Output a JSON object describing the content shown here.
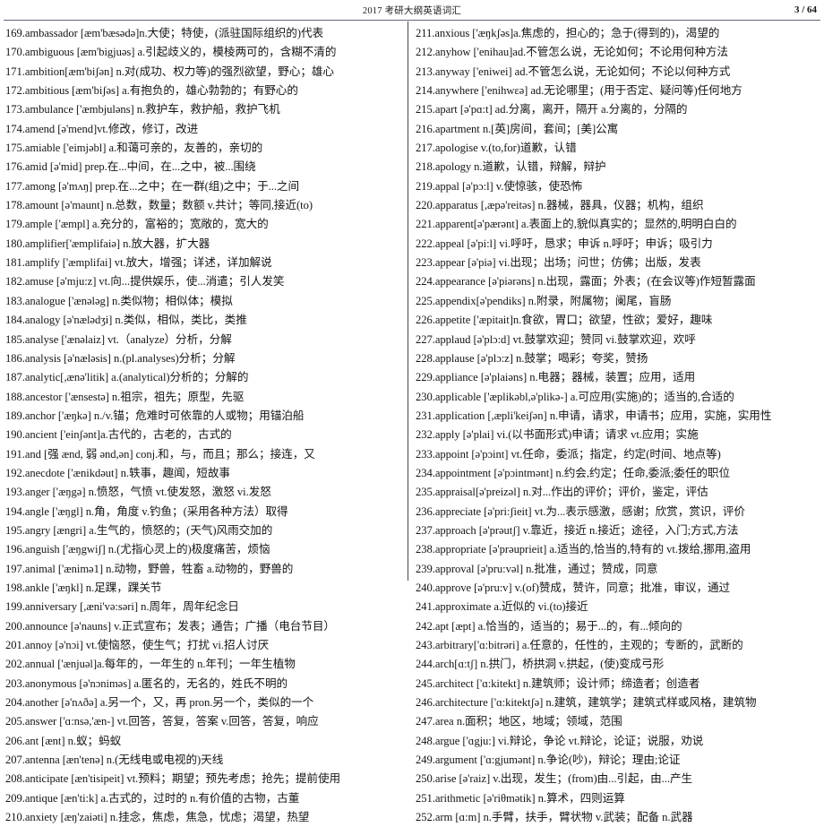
{
  "header": {
    "title": "2017 考研大纲英语词汇",
    "page_number": "3 / 64"
  },
  "columns": {
    "left": [
      "169.ambassador    [æm'bæsədə]n.大使；特使，(派驻国际组织的)代表",
      "170.ambiguous     [æm'bigjuəs] a.引起歧义的，模棱两可的，含糊不清的",
      "171.ambition[æm'biʃən]    n.对(成功、权力等)的强烈欲望，野心；雄心",
      "172.ambitious     [æm'biʃəs]    a.有抱负的，雄心勃勃的；有野心的",
      "173.ambulance     ['æmbjuləns] n.救护车，救护船，救护飞机",
      "174.amend   [ə'mend]vt.修改，修订，改进",
      "175.amiable  ['eimjəbl]      a.和蔼可亲的，友善的，亲切的",
      "176.amid     [ə'mid]  prep.在...中间，在...之中，被...围绕",
      "177.among    [ə'mʌŋ]  prep.在...之中；在一群(组)之中；于...之间",
      "178.amount  [ə'maunt]        n.总数，数量；数额 v.共计；等同,接近(to)",
      "179.ample    ['æmpl]  a.充分的，富裕的；宽敞的，宽大的",
      "180.amplifier['æmplifaiə]  n.放大器，扩大器",
      "181.amplify  ['æmplifai]    vt.放大，增强；详述，详加解说",
      "182.amuse    [ə'mju:z] vt.向...提供娱乐，使...消遣；引人发笑",
      "183.analogue  ['ænələg]      n.类似物；相似体；模拟",
      "184.analogy  [ə'nælədʒi]    n.类似，相似，类比，类推",
      "185.analyse  ['ænəlaiz]    vt.（analyze）分析，分解",
      "186.analysis  [ə'næləsis]    n.(pl.analyses)分析；分解",
      "187.analytic[,ænə'litik]      a.(analytical)分析的；分解的",
      "188.ancestor ['ænsestə]     n.祖宗，祖先；原型，先驱",
      "189.anchor   ['æŋkə]  n./v.锚；危难时可依靠的人或物；用锚泊船",
      "190.ancient  ['einʃənt]a.古代的，古老的，古式的",
      "191.and   [强 ænd, 弱 ənd,ən]      conj.和，与，而且；那么；接连，又",
      "192.anecdote ['ænikdəut]   n.轶事，趣闻，短故事",
      "193.anger     ['æŋgə]  n.愤怒，气愤 vt.使发怒，激怒 vi.发怒",
      "194.angle     ['æŋgl]   n.角，角度 v.钓鱼；(采用各种方法）取得",
      "195.angry     [ængri] a.生气的，愤怒的；(天气)风雨交加的",
      "196.anguish  ['æŋgwiʃ]      n.(尤指心灵上的)极度痛苦，烦恼",
      "197.animal   ['ænimə1]      n.动物，野兽，牲畜 a.动物的，野兽的",
      "198.ankle    ['æŋkl]  n.足踝，踝关节",
      "199.anniversary   [,æni'və:səri]      n.周年，周年纪念日",
      "200.announce     [ə'nauns]       v.正式宣布；发表；通告；广播（电台节目）",
      "201.annoy    [ə'nɔi]   vt.使恼怒，使生气；打扰 vi.招人讨厌",
      "202.annual   ['ænjuəl]a.每年的，一年生的 n.年刊；一年生植物",
      "203.anonymous   [ə'nɔniməs]   a.匿名的，无名的，姓氏不明的",
      "204.another  [ə'nʌðə] a.另一个，又，再 pron.另一个，类似的一个",
      "205.answer   ['ɑ:nsə,'æn-]      vt.回答，答复，答案 v.回答，答复，响应",
      "206.ant  [ænt]     n.蚁；蚂蚁",
      "207.antenna [æn'tenə]      n.(无线电或电视的)天线",
      "208.anticipate     [æn'tisipeit] vt.预料；期望；预先考虑；抢先；提前使用",
      "209.antique  [æn'ti:k] a.古式的，过时的   n.有价值的古物，古董",
      "210.anxiety  [æŋ'zaiəti]    n.挂念，焦虑，焦急，忧虑；渴望，热望"
    ],
    "right": [
      "211.anxious  ['æŋkʃəs]a.焦虑的，担心的；急于(得到的)，渴望的",
      "212.anyhow  ['enihau]ad.不管怎么说，无论如何；不论用何种方法",
      "213.anyway  ['eniwei] ad.不管怎么说，无论如何；不论以何种方式",
      "214.anywhere       ['enihwɛə]      ad.无论哪里；(用于否定、疑问等)任何地方",
      "215.apart      [ə'pɑ:t]   ad.分离，离开，隔开 a.分离的，分隔的",
      "216.apartment      n.[英]房间，套间；[美]公寓",
      "217.apologise  v.(to,for)道歉，认错",
      "218.apology n.道歉，认错，辩解，辩护",
      "219.appal     [ə'pɔ:l]   v.使惊骇，使恐怖",
      "220.apparatus        [,æpə'reitəs]        n.器械，器具，仪器；机构，组织",
      "221.apparent[ə'pærənt]      a.表面上的,貌似真实的；显然的,明明白白的",
      "222.appeal   [ə'pi:l]   vi.呼吁，恳求；申诉 n.呼吁；申诉；吸引力",
      "223.appear   [ə'piə]    vi.出现；出场；问世；仿佛；出版，发表",
      "224.appearance   [ə'piərəns]    n.出现，露面；外表；(在会议等)作短暂露面",
      "225.appendix[ə'pendiks]    n.附录，附属物；阑尾，盲肠",
      "226.appetite ['æpitait]n.食欲，胃口；欲望，性欲；爱好，趣味",
      "227.applaud  [ə'plɔ:d] vt.鼓掌欢迎；赞同 vi.鼓掌欢迎，欢呼",
      "228.applause [ə'plɔ:z]  n.鼓掌；喝彩；夸奖，赞扬",
      "229.appliance       [ə'plaiəns]      n.电器；器械，装置；应用，适用",
      "230.applicable      ['æplikəbl,ə'plikə-]      a.可应用(实施)的；适当的,合适的",
      "231.application     [,æpli'keiʃən]      n.申请，请求，申请书；应用，实施，实用性",
      "232.apply     [ə'plai]   vi.(以书面形式)申请；请求 vt.应用；实施",
      "233.appoint  [ə'pɔint] vt.任命，委派；指定，约定(时间、地点等)",
      "234.appointment [ə'pɔintmənt]  n.约会,约定；任命,委派;委任的职位",
      "235.appraisal[ə'preizəl]      n.对...作出的评价；评价，鉴定，评估",
      "236.appreciate     [ə'pri:ʃieit]    vt.为...表示感激，感谢；欣赏，赏识，评价",
      "237.approach       [ə'prəutʃ]         v.靠近，接近 n.接近；途径，入门;方式,方法",
      "238.appropriate   [ə'prəuprieit] a.适当的,恰当的,特有的 vt.拨给,挪用,盗用",
      "239.approval [ə'pru:vəl]     n.批准，通过；赞成，同意",
      "240.approve [ə'pru:v] v.(of)赞成，赞许，同意；批准，审议，通过",
      "241.approximate        a.近似的 vi.(to)接近",
      "242.apt  [æpt]      a.恰当的，适当的；易于...的，有...倾向的",
      "243.arbitrary['ɑ:bitrəri]      a.任意的，任性的，主观的；专断的，武断的",
      "244.arch[ɑ:tʃ]       n.拱门，桥拱洞 v.拱起，(使)变成弓形",
      "245.architect ['ɑ:kitekt]       n.建筑师；设计师；缔造者；创造者",
      "246.architecture  ['ɑ:kitektʃə]   n.建筑，建筑学；建筑式样或风格，建筑物",
      "247.area n.面积；地区，地域；领域，范围",
      "248.argue     ['ɑgju:]   vi.辩论，争论 vt.辩论，论证；说服，劝说",
      "249.argument      ['ɑ:gjumənt] n.争论(吵)，辩论；理由;论证",
      "250.arise      [ə'raiz]   v.出现，发生；(from)由...引起，由...产生",
      "251.arithmetic      [ə'riθmətik]  n.算术，四则运算",
      "252.arm [ɑ:m]      n.手臂，扶手，臂状物 v.武装；配备 n.武器"
    ]
  }
}
